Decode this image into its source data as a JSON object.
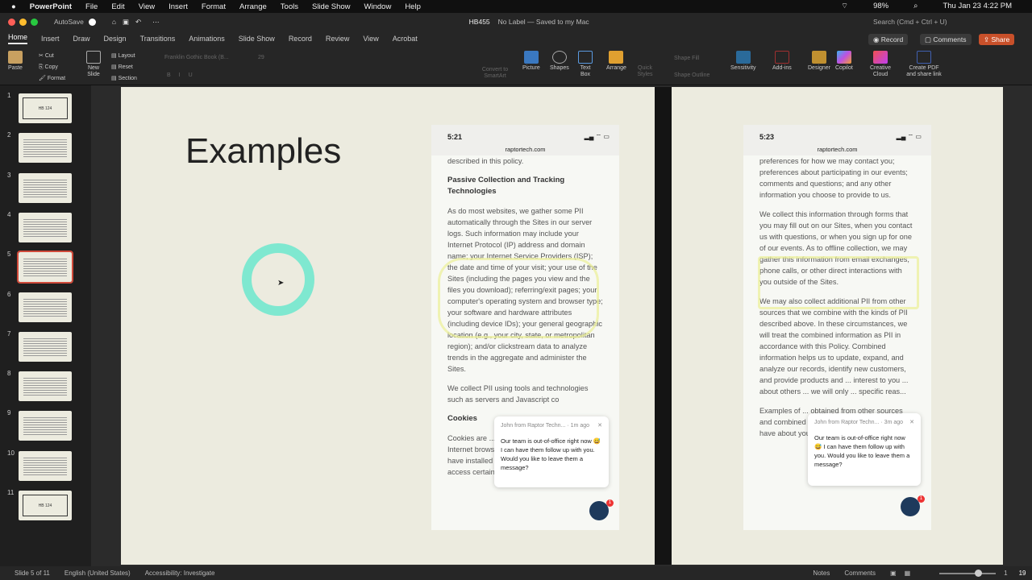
{
  "menubar": {
    "app": "PowerPoint",
    "items": [
      "File",
      "Edit",
      "View",
      "Insert",
      "Format",
      "Arrange",
      "Tools",
      "Slide Show",
      "Window",
      "Help"
    ],
    "battery": "98%",
    "datetime": "Thu Jan 23  4:22 PM"
  },
  "titlebar": {
    "autosave": "AutoSave",
    "doc": "HB455",
    "label": "No Label — Saved to my Mac",
    "search_placeholder": "Search (Cmd + Ctrl + U)"
  },
  "tabs": [
    "Home",
    "Insert",
    "Draw",
    "Design",
    "Transitions",
    "Animations",
    "Slide Show",
    "Record",
    "Review",
    "View",
    "Acrobat"
  ],
  "tab_buttons": {
    "record": "Record",
    "comments": "Comments",
    "share": "Share"
  },
  "ribbon": {
    "paste": "Paste",
    "cut": "Cut",
    "copy": "Copy",
    "format": "Format",
    "new_slide": "New Slide",
    "layout": "Layout",
    "reset": "Reset",
    "section": "Section",
    "font": "Franklin Gothic Book (B...",
    "size": "29",
    "convert": "Convert to SmartArt",
    "picture": "Picture",
    "shapes": "Shapes",
    "textbox": "Text Box",
    "arrange": "Arrange",
    "quick_styles": "Quick Styles",
    "shape_fill": "Shape Fill",
    "shape_outline": "Shape Outline",
    "sensitivity": "Sensitivity",
    "addins": "Add-ins",
    "designer": "Designer",
    "copilot": "Copilot",
    "creative_cloud": "Creative Cloud",
    "create_pdf": "Create PDF and share link"
  },
  "thumbnails": [
    {
      "n": "1",
      "text": "HB 124"
    },
    {
      "n": "2"
    },
    {
      "n": "3"
    },
    {
      "n": "4"
    },
    {
      "n": "5"
    },
    {
      "n": "6"
    },
    {
      "n": "7"
    },
    {
      "n": "8"
    },
    {
      "n": "9"
    },
    {
      "n": "10"
    },
    {
      "n": "11",
      "text": "HB 124"
    }
  ],
  "slide": {
    "title": "Examples"
  },
  "phone1": {
    "time": "5:21",
    "url": "raptortech.com",
    "p0": "described in this policy.",
    "h1": "Passive Collection and Tracking Technologies",
    "p1": "As do most websites, we gather some PII automatically through the Sites in our server logs. Such information may include your Internet Protocol (IP) address and domain name; your Internet Service Providers (ISP); the date and time of your visit; your use of the Sites (including the pages you view and the files you download); referring/exit pages; your computer's operating system and browser type; your software and hardware attributes (including device IDs); your general geographic location (e.g., your city, state, or metropolitan region); and/or clickstream data to analyze trends in the aggregate and administer the Sites.",
    "p2": "We collect PII using tools and technologies such as servers and Javascript co",
    "h2": "Cookies",
    "p3": "Cookies are ... we place on your computer ... Internet browser and to determine whether you have installed the enabling software needed to access certain material",
    "chat_from": "John from Raptor Techn...",
    "chat_ago": "1m ago",
    "chat_msg": "Our team is out-of-office right now 😅 I can have them follow up with you. Would you like to leave them a message?",
    "badge": "1"
  },
  "phone2": {
    "time": "5:23",
    "url": "raptortech.com",
    "p1": "preferences for how we may contact you; preferences about participating in our events; comments and questions; and any other information you choose to provide to us.",
    "p2": "We collect this information through forms that you may fill out on our Sites, when you contact us with questions, or when you sign up for one of our events. As to offline collection, we may gather this information from email exchanges, phone calls, or other direct interactions with you outside of the Sites.",
    "p3": "We may also collect additional PII from other sources that we combine with the kinds of PII described above. In these circumstances, we will treat the combined information as PII in accordance with this Policy. Combined information helps us to update, expand, and analyze our records, identify new customers, and provide products and ... interest to you ... about others ... we will only ... specific reas...",
    "p4": "Examples of ... obtained from other sources and combined with information we already have about you through the Sites may",
    "chat_from": "John from Raptor Techn...",
    "chat_ago": "3m ago",
    "chat_msg": "Our team is out-of-office right now 😅 I can have them follow up with you. Would you like to leave them a message?",
    "badge": "1"
  },
  "status": {
    "slide": "Slide 5 of 11",
    "lang": "English (United States)",
    "access": "Accessibility: Investigate",
    "notes": "Notes",
    "comments": "Comments",
    "zoom": "1",
    "count": "19"
  }
}
